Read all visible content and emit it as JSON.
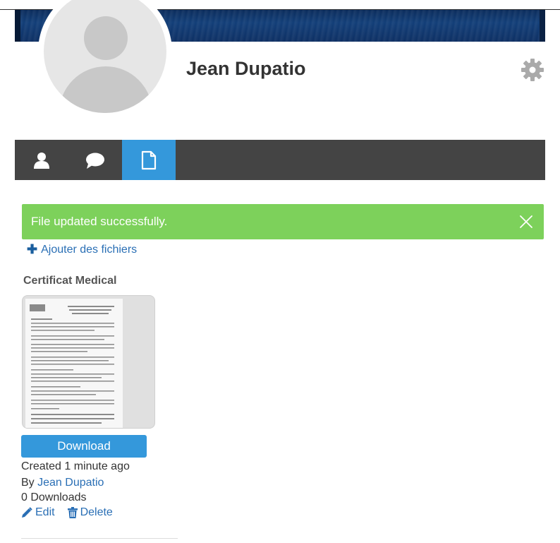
{
  "profile": {
    "name": "Jean Dupatio"
  },
  "tabs": [
    {
      "icon": "user-icon",
      "active": false
    },
    {
      "icon": "comment-icon",
      "active": false
    },
    {
      "icon": "file-icon",
      "active": true
    }
  ],
  "alert": {
    "message": "File updated successfully.",
    "color": "#7dd15b"
  },
  "actions": {
    "add_files_label": "Ajouter des fichiers"
  },
  "file": {
    "title": "Certificat Medical",
    "download_label": "Download",
    "created": "Created 1 minute ago",
    "by_prefix": "By",
    "author": "Jean Dupatio",
    "downloads": "0 Downloads",
    "edit_label": "Edit",
    "delete_label": "Delete"
  },
  "colors": {
    "accent": "#3498db",
    "link": "#2a6fb5",
    "tabbar": "#444444"
  }
}
